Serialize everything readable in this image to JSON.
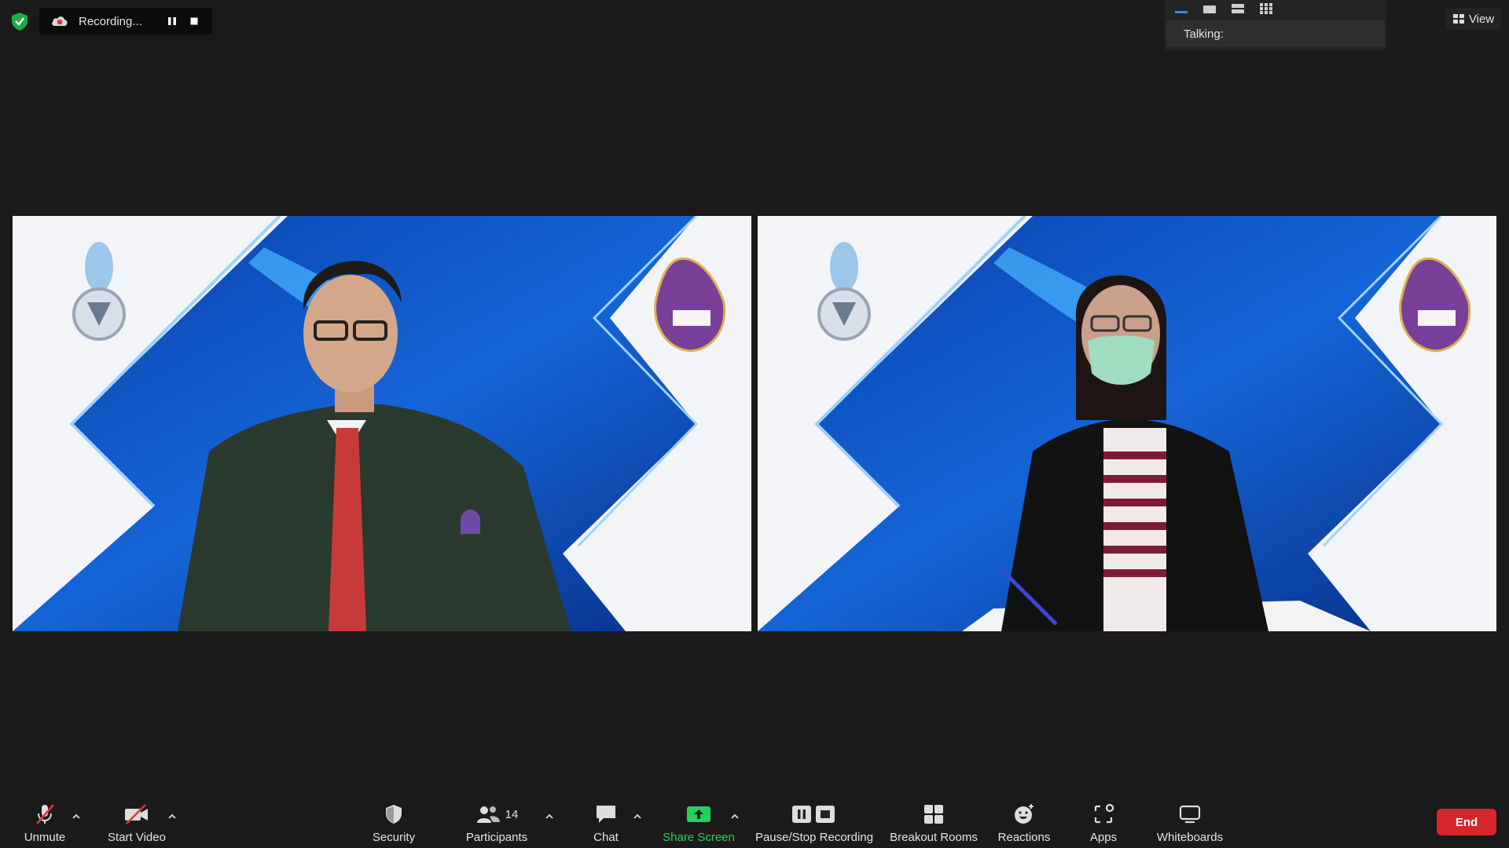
{
  "recording": {
    "status_text": "Recording..."
  },
  "layout_panel": {
    "talking_label": "Talking:"
  },
  "view_button": {
    "label": "View"
  },
  "toolbar": {
    "unmute": "Unmute",
    "start_video": "Start Video",
    "security": "Security",
    "participants": "Participants",
    "participants_count": "14",
    "chat": "Chat",
    "share_screen": "Share Screen",
    "pause_stop_recording": "Pause/Stop Recording",
    "breakout_rooms": "Breakout Rooms",
    "reactions": "Reactions",
    "apps": "Apps",
    "whiteboards": "Whiteboards",
    "end": "End"
  },
  "colors": {
    "background": "#1a1a1a",
    "share_green": "#23d15b",
    "end_red": "#d7262c",
    "muted_red": "#e2343a",
    "tile_blue": "#0d47b0",
    "logo_purple": "#7a3f99"
  },
  "icons": {
    "security_status": "green-shield-icon",
    "recording": "cloud-recording-icon",
    "pause": "pause-icon",
    "stop": "stop-icon",
    "mic": "mic-muted-icon",
    "video": "video-off-icon"
  }
}
